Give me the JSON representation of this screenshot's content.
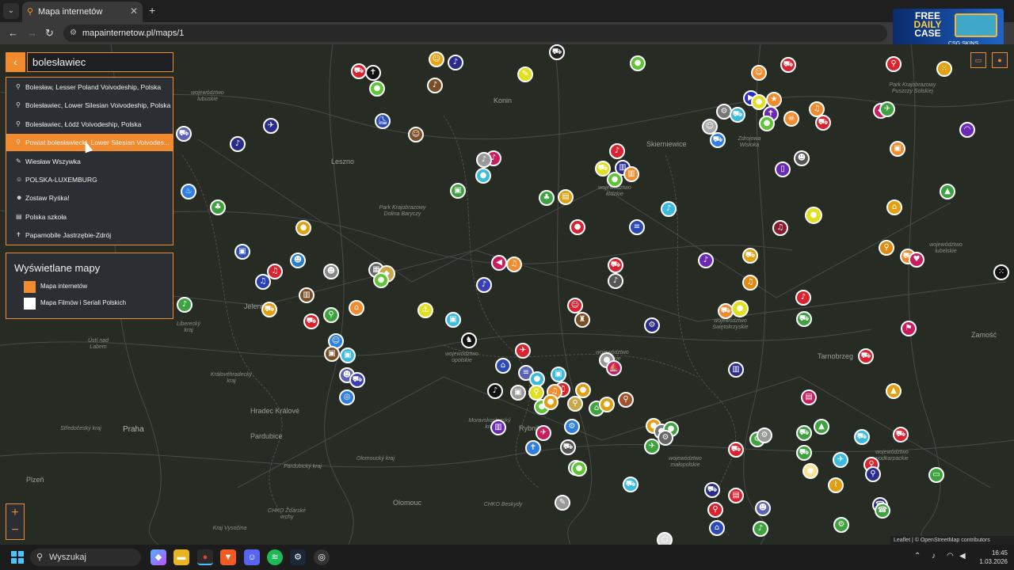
{
  "browser": {
    "tab_title": "Mapa internetów",
    "url": "mapainternetow.pl/maps/1"
  },
  "ad": {
    "line1": "FREE",
    "line2": "DAILY",
    "line3": "CASE",
    "brand": "CSG SKINS"
  },
  "search": {
    "value": "bolesławiec",
    "results": [
      {
        "icon": "location-pin-icon",
        "glyph": "⚲",
        "label": "Bolesław, Lesser Poland Voivodeship, Polska"
      },
      {
        "icon": "location-pin-icon",
        "glyph": "⚲",
        "label": "Bolesławiec, Lower Silesian Voivodeship, Polska"
      },
      {
        "icon": "location-pin-icon",
        "glyph": "⚲",
        "label": "Bolesławiec, Łódź Voivodeship, Polska"
      },
      {
        "icon": "location-pin-icon",
        "glyph": "⚲",
        "label": "Powiat bolesławiecki, Lower Silesian Voivodes..."
      },
      {
        "icon": "pencil-icon",
        "glyph": "✎",
        "label": "Wiesław Wszywka"
      },
      {
        "icon": "person-icon",
        "glyph": "☺",
        "label": "POLSKA-LUXEMBURG"
      },
      {
        "icon": "people-icon",
        "glyph": "☻",
        "label": "Zostaw Ryśka!"
      },
      {
        "icon": "school-icon",
        "glyph": "▤",
        "label": "Polska szkoła"
      },
      {
        "icon": "cross-icon",
        "glyph": "✝",
        "label": "Papamobile Jastrzębie-Zdrój"
      }
    ],
    "active_index": 3
  },
  "maps_panel": {
    "title": "Wyświetlane mapy",
    "items": [
      {
        "label": "Mapa internetów",
        "color": "#f18b2e"
      },
      {
        "label": "Mapa Filmów i Seriali Polskich",
        "color": "#ffffff"
      }
    ]
  },
  "map": {
    "labels": {
      "konin": "Konin",
      "leszno": "Leszno",
      "skierniewice": "Skierniewice",
      "praha": "Praha",
      "tarnobrzeg": "Tarnobrzeg",
      "zamosc": "Zamość",
      "rybnik": "Rybnik",
      "olomouc": "Olomouc",
      "plzen": "Plzeň",
      "pardubice": "Pardubice",
      "hradec": "Hradec Králové",
      "jelenia": "Jelenia",
      "usti": "Ústí nad Labem",
      "liberecky": "Liberecký kraj",
      "lodzkie": "województwo łódzkie",
      "swietokrzyskie": "województwo świętokrzyskie",
      "malopolskie": "województwo małopolskie",
      "podkarpackie": "województwo podkarpackie",
      "lubelskie": "województwo lubelskie",
      "lubuskie": "województwo lubuskie",
      "opolskie": "województwo opolskie",
      "slaskie": "województwo śląskie",
      "dolinabaryczy": "Park Krajobrazowy Dolina Baryczy",
      "zagorzyce": "Zdrojowa Wisłoka",
      "moravskoslezsky": "Moravskoslezský kraj",
      "kralovehradecky": "Královéhradecký kraj",
      "stredocesky": "Středočeský kraj",
      "olomoucky": "Olomoucký kraj",
      "pardubicky": "Pardubický kraj",
      "vysocina": "Kraj Vysočina",
      "zdarske": "CHKO Žďárské vrchy",
      "beskydy": "CHKO Beskydy",
      "stawki": "Park Krajobrazowy Puszczy Solskiej"
    },
    "attribution": "Leaflet | © OpenStreetMap contributors"
  },
  "zoom": {
    "in": "+",
    "out": "−"
  },
  "taskbar": {
    "search_placeholder": "Wyszukaj",
    "time": "16:45",
    "date": "1.03.2026"
  },
  "colors": {
    "accent": "#f18b2e",
    "panel": "#2b2f33",
    "map_bg": "#262b24"
  }
}
